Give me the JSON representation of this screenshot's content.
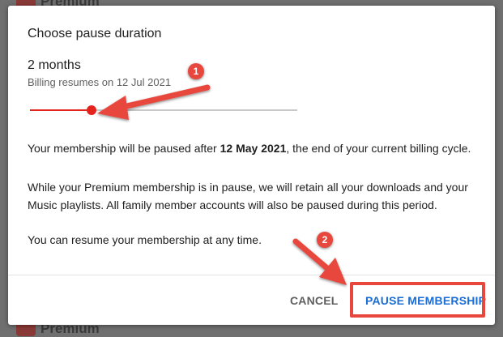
{
  "background": {
    "logo_top_text": "Premium",
    "logo_bottom_text": "Premium"
  },
  "dialog": {
    "title": "Choose pause duration",
    "duration_value": "2 months",
    "billing_resumes": "Billing resumes on 12 Jul 2021",
    "slider_level": 0.23,
    "paragraph1": {
      "before": "Your membership will be paused after ",
      "date": "12 May 2021",
      "after": ", the end of your current billing cycle."
    },
    "paragraph2": "While your Premium membership is in pause, we will retain all your downloads and your Music playlists. All family member accounts will also be paused during this period.",
    "paragraph3": "You can resume your membership at any time.",
    "cancel_label": "CANCEL",
    "pause_label": "PAUSE MEMBERSHIP"
  },
  "annotations": {
    "marker1": "1",
    "marker2": "2",
    "color": "#e8473d"
  },
  "colors": {
    "accent_red": "#e5231d",
    "link_blue": "#1a6dd6"
  },
  "icons": {
    "slider": "slider-thumb",
    "logo": "youtube-logo-icon"
  }
}
